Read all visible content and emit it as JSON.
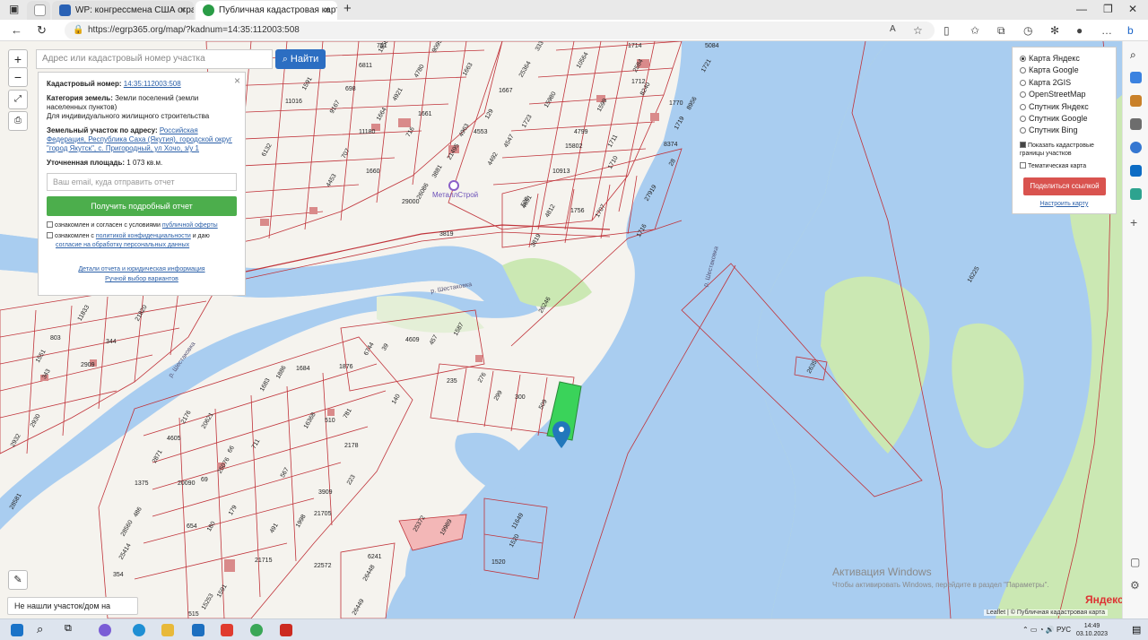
{
  "browser": {
    "tabs": [
      {
        "label": "",
        "active": false
      },
      {
        "label": "WP: конгрессмена США ограбі",
        "active": false
      },
      {
        "label": "Публичная кадастровая карта Р",
        "active": true
      }
    ],
    "new_tab_label": "+",
    "url": "https://egrp365.org/map/?kadnum=14:35:112003:508"
  },
  "map": {
    "search_placeholder": "Адрес или кадастровый номер участка",
    "find_button": "Найти",
    "zoom_in": "+",
    "zoom_out": "−",
    "not_found_label": "Не нашли участок/дом на карте?",
    "yandex_logo": "Яндекс",
    "attribution": "Leaflet | © Публичная кадастровая карта",
    "watermark_title": "Активация Windows",
    "watermark_text": "Чтобы активировать Windows, перейдите в раздел \"Параметры\".",
    "river_label_1": "р. Шестаковка",
    "river_label_2": "р. Шестаковка",
    "river_label_3": "р. Шестаковка",
    "poi_label": "МеталлСтрой",
    "plot_labels": [
      "751",
      "9095",
      "333",
      "5084",
      "10564",
      "2584",
      "1714",
      "1721",
      "1591",
      "6811",
      "4780",
      "1663",
      "698",
      "4921",
      "1664",
      "1661",
      "716",
      "129",
      "1667",
      "25364",
      "15980",
      "1712",
      "1599",
      "8240",
      "1770",
      "8956",
      "1719",
      "11016",
      "9167",
      "4963",
      "4553",
      "4547",
      "1723",
      "4799",
      "1711",
      "1710",
      "8374",
      "6132",
      "707",
      "11180",
      "21495",
      "4492",
      "15802",
      "28",
      "3881",
      "1660",
      "4453",
      "26086",
      "10913",
      "27919",
      "4651",
      "29000",
      "528",
      "4812",
      "1756",
      "1707",
      "1716",
      "3819",
      "3819",
      "26246",
      "803",
      "1551",
      "343",
      "2909",
      "11833",
      "21820",
      "344",
      "2930",
      "2932",
      "1876",
      "6744",
      "39",
      "4609",
      "457",
      "1587",
      "235",
      "276",
      "299",
      "300",
      "509",
      "140",
      "510",
      "781",
      "16368",
      "2178",
      "223",
      "1886",
      "1684",
      "1683",
      "2176",
      "4605",
      "25076",
      "711",
      "69",
      "66",
      "567",
      "1375",
      "486",
      "28560",
      "654",
      "180",
      "179",
      "20090",
      "2871",
      "20621",
      "21705",
      "1998",
      "491",
      "21715",
      "11649",
      "1520",
      "1520",
      "25372",
      "19989",
      "6241",
      "26448",
      "26449",
      "22572",
      "1591",
      "15253",
      "515",
      "16225",
      "2635",
      "354",
      "25414",
      "28581",
      "3909",
      "1958"
    ]
  },
  "info_panel": {
    "close_label": "×",
    "kadnum_label": "Кадастровый номер:",
    "kadnum_value": "14:35:112003:508",
    "category_label": "Категория земель:",
    "category_value": "Земли поселений (земли населенных пунктов)",
    "usage_value": "Для индивидуального жилищного строительства",
    "address_label": "Земельный участок по адресу:",
    "address_value": "Российская Федерация, Республика Саха (Якутия), городской округ \"город Якутск\", с. Пригородный, ул Хочо, з/у 1",
    "area_label": "Уточненная площадь:",
    "area_value": "1 073 кв.м.",
    "email_placeholder": "Ваш email, куда отправить отчет",
    "report_button": "Получить подробный отчет",
    "check1_prefix": "ознакомлен и согласен с условиями",
    "check1_link": "публичной оферты",
    "check2_prefix": "ознакомлен с",
    "check2_link": "политикой конфиденциальности",
    "check2_suffix": "и даю",
    "check2_link2": "согласие на обработку персональных данных",
    "link_details": "Детали отчета и юридическая информация",
    "link_manual": "Ручной выбор вариантов"
  },
  "layers_panel": {
    "options": [
      {
        "label": "Карта Яндекс",
        "selected": true
      },
      {
        "label": "Карта Google",
        "selected": false
      },
      {
        "label": "Карта 2GIS",
        "selected": false
      },
      {
        "label": "OpenStreetMap",
        "selected": false
      },
      {
        "label": "Спутник Яндекс",
        "selected": false
      },
      {
        "label": "Спутник Google",
        "selected": false
      },
      {
        "label": "Спутник Bing",
        "selected": false
      }
    ],
    "show_borders_label": "Показать кадастровые границы участков",
    "show_borders_checked": true,
    "thematic_label": "Тематическая карта",
    "thematic_checked": false,
    "share_button": "Поделиться ссылкой",
    "setup_link": "Настроить карту"
  },
  "system": {
    "lang": "РУС",
    "time": "14:49",
    "date": "03.10.2023"
  },
  "colors": {
    "water": "#a9cdf0",
    "green": "#c8e6b0",
    "plot_border": "#c0333a",
    "selected_plot": "#3ad35a",
    "pin": "#2277bb"
  }
}
